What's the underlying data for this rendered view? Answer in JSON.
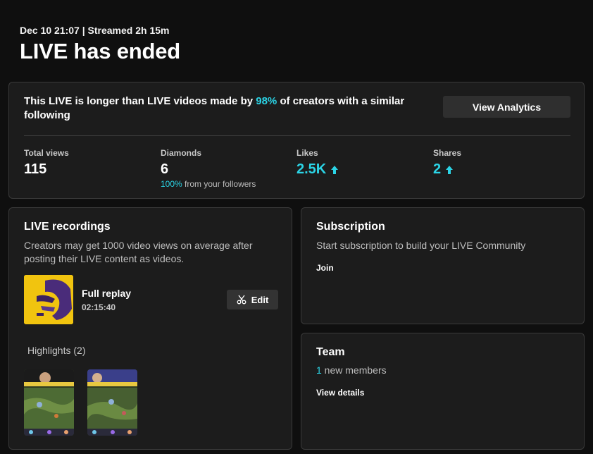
{
  "header": {
    "meta": "Dec 10 21:07 | Streamed 2h 15m",
    "title": "LIVE has ended"
  },
  "summary": {
    "text_before": "This LIVE is longer than LIVE videos made by ",
    "percent": "98%",
    "text_after": " of creators with a similar following",
    "analytics_button": "View Analytics",
    "stats": {
      "views": {
        "label": "Total views",
        "value": "115"
      },
      "diamonds": {
        "label": "Diamonds",
        "value": "6",
        "sub_percent": "100%",
        "sub_text": " from your followers"
      },
      "likes": {
        "label": "Likes",
        "value": "2.5K"
      },
      "shares": {
        "label": "Shares",
        "value": "2"
      }
    }
  },
  "recordings": {
    "title": "LIVE recordings",
    "description": "Creators may get 1000 video views on average after posting their LIVE content as videos.",
    "replay_label": "Full replay",
    "replay_duration": "02:15:40",
    "edit_button": "Edit",
    "highlights_title": "Highlights (2)"
  },
  "subscription": {
    "title": "Subscription",
    "description": "Start subscription to build your LIVE Community",
    "join_link": "Join"
  },
  "team": {
    "title": "Team",
    "count": "1",
    "count_text": " new members",
    "details_link": "View details"
  },
  "colors": {
    "accent": "#2bd4e6",
    "background": "#0f0f0f",
    "card": "#1c1c1c",
    "replay_thumb": "#f1c40f"
  },
  "icons": {
    "likes_trend": "up-arrow-icon",
    "shares_trend": "up-arrow-icon",
    "edit": "scissors-icon"
  }
}
